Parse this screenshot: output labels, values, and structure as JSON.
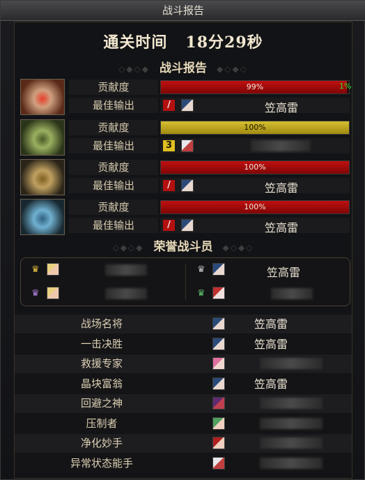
{
  "window": {
    "title": "战斗报告"
  },
  "summary": {
    "clear_time_label": "通关时间",
    "clear_time_value": "18分29秒"
  },
  "battle_report": {
    "section_title": "战斗报告",
    "contribution_label": "贡献度",
    "best_output_label": "最佳输出",
    "bosses": [
      {
        "boss_icon": "red-flame-mask-icon",
        "contribution_pct": 99,
        "contribution_text": "99%",
        "extra_pct_text": "1%",
        "bar_color": "#b01010",
        "rank_badge": "/",
        "rank_color": "#b41010",
        "avatar": "blue-hair-avatar-icon",
        "player_name": "笠高雷",
        "name_hidden": false
      },
      {
        "boss_icon": "green-spike-mask-icon",
        "contribution_pct": 100,
        "contribution_text": "100%",
        "bar_color": "#c8b028",
        "rank_badge": "3",
        "rank_color": "#e0c020",
        "avatar": "white-hair-avatar-icon",
        "player_name": "",
        "name_hidden": true
      },
      {
        "boss_icon": "gold-spike-mask-icon",
        "contribution_pct": 100,
        "contribution_text": "100%",
        "bar_color": "#b01010",
        "rank_badge": "/",
        "rank_color": "#b41010",
        "avatar": "blue-hair-avatar-icon",
        "player_name": "笠高雷",
        "name_hidden": false
      },
      {
        "boss_icon": "ice-spike-mask-icon",
        "contribution_pct": 100,
        "contribution_text": "100%",
        "bar_color": "#b01010",
        "rank_badge": "/",
        "rank_color": "#b41010",
        "avatar": "blue-hair-avatar-icon",
        "player_name": "笠高雷",
        "name_hidden": false
      }
    ]
  },
  "honor": {
    "section_title": "荣誉战斗员",
    "members": [
      {
        "crown": "gold-crown-icon",
        "avatar": "blonde-avatar-icon",
        "name": "",
        "hidden": true
      },
      {
        "crown": "silver-crown-icon",
        "avatar": "blue-hair-avatar-icon",
        "name": "笠高雷",
        "hidden": false
      },
      {
        "crown": "purple-crown-icon",
        "avatar": "blonde-avatar-icon",
        "name": "",
        "hidden": true
      },
      {
        "crown": "green-crown-icon",
        "avatar": "red-white-avatar-icon",
        "name": "",
        "hidden": true
      }
    ]
  },
  "awards": [
    {
      "title": "战场名将",
      "avatar": "blue-hair-avatar-icon",
      "name": "笠高雷",
      "hidden": false
    },
    {
      "title": "一击决胜",
      "avatar": "blue-hair-avatar-icon",
      "name": "笠高雷",
      "hidden": false
    },
    {
      "title": "救援专家",
      "avatar": "pink-hair-avatar-icon",
      "name": "",
      "hidden": true
    },
    {
      "title": "晶块富翁",
      "avatar": "blue-hair-avatar-icon",
      "name": "笠高雷",
      "hidden": false
    },
    {
      "title": "回避之神",
      "avatar": "purple-avatar-icon",
      "name": "",
      "hidden": true
    },
    {
      "title": "压制者",
      "avatar": "green-hair-avatar-icon",
      "name": "",
      "hidden": true
    },
    {
      "title": "净化妙手",
      "avatar": "red-hair-avatar-icon",
      "name": "",
      "hidden": true
    },
    {
      "title": "异常状态能手",
      "avatar": "white-hair-avatar-icon",
      "name": "",
      "hidden": true
    }
  ],
  "colors": {
    "accent_red": "#b01010",
    "accent_yellow": "#c8b028",
    "percent_green": "#2ee02e",
    "gold_text": "#e6d8b8"
  }
}
